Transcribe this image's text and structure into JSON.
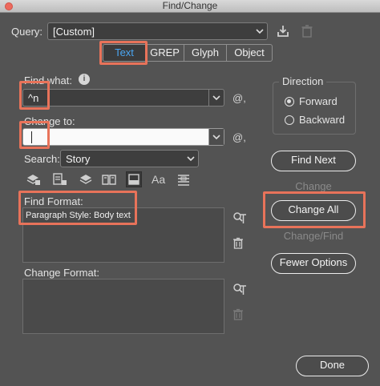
{
  "window": {
    "title": "Find/Change"
  },
  "query": {
    "label": "Query:",
    "value": "[Custom]"
  },
  "tabs": [
    {
      "label": "Text",
      "selected": true
    },
    {
      "label": "GREP"
    },
    {
      "label": "Glyph"
    },
    {
      "label": "Object"
    }
  ],
  "find_what": {
    "label": "Find what:",
    "value": "^n"
  },
  "change_to": {
    "label": "Change to:",
    "value": ""
  },
  "search": {
    "label": "Search:",
    "value": "Story"
  },
  "option_icons": [
    "locked-layers-icon",
    "locked-stories-icon",
    "hidden-layers-icon",
    "master-pages-icon",
    "footnotes-icon",
    "case-sensitive-icon",
    "whole-word-icon"
  ],
  "find_format": {
    "label": "Find Format:",
    "value": "Paragraph Style: Body text"
  },
  "change_format": {
    "label": "Change Format:",
    "value": ""
  },
  "direction": {
    "label": "Direction",
    "options": [
      {
        "label": "Forward",
        "selected": true
      },
      {
        "label": "Backward",
        "selected": false
      }
    ]
  },
  "buttons": {
    "find_next": "Find Next",
    "change": "Change",
    "change_all": "Change All",
    "change_find": "Change/Find",
    "fewer_options": "Fewer Options",
    "done": "Done"
  },
  "symbols": {
    "at": "@,",
    "case": "Aa",
    "info": "i"
  },
  "colors": {
    "accent": "#4aa6f2",
    "highlight": "#e8735a",
    "background": "#535353"
  }
}
